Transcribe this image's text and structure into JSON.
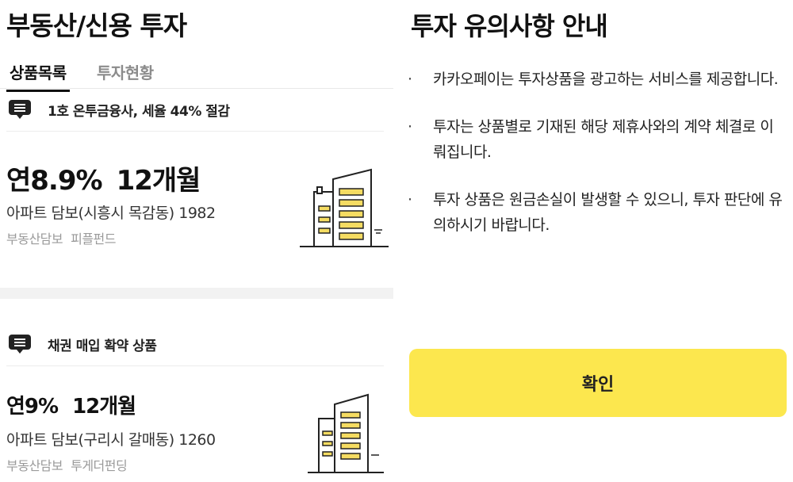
{
  "left": {
    "title": "부동산/신용 투자",
    "tabs": [
      {
        "label": "상품목록",
        "active": true
      },
      {
        "label": "투자현황",
        "active": false
      }
    ],
    "products": [
      {
        "notice": "1호 온투금융사, 세율 44% 절감",
        "rate": "연8.9%",
        "term": "12개월",
        "name": "아파트 담보(시흥시 목감동) 1982",
        "tags": [
          "부동산담보",
          "피플펀드"
        ]
      },
      {
        "notice": "채권 매입 확약 상품",
        "rate": "연9%",
        "term": "12개월",
        "name": "아파트 담보(구리시 갈매동) 1260",
        "tags": [
          "부동산담보",
          "투게더펀딩"
        ]
      }
    ]
  },
  "modal": {
    "title": "투자 유의사항 안내",
    "items": [
      "카카오페이는 투자상품을 광고하는 서비스를 제공합니다.",
      "투자는 상품별로 기재된 해당 제휴사와의 계약 체결로 이뤄집니다.",
      "투자 상품은 원금손실이 발생할 수 있으니, 투자 판단에 유의하시기 바랍니다."
    ],
    "bullet": "·",
    "confirm_label": "확인"
  },
  "colors": {
    "accent_yellow": "#fce74e",
    "building_yellow": "#f5dc62",
    "text_dark": "#111111",
    "text_muted": "#9a9a9a"
  },
  "icons": {
    "notice": "message-list-icon",
    "product": "building-icon"
  }
}
